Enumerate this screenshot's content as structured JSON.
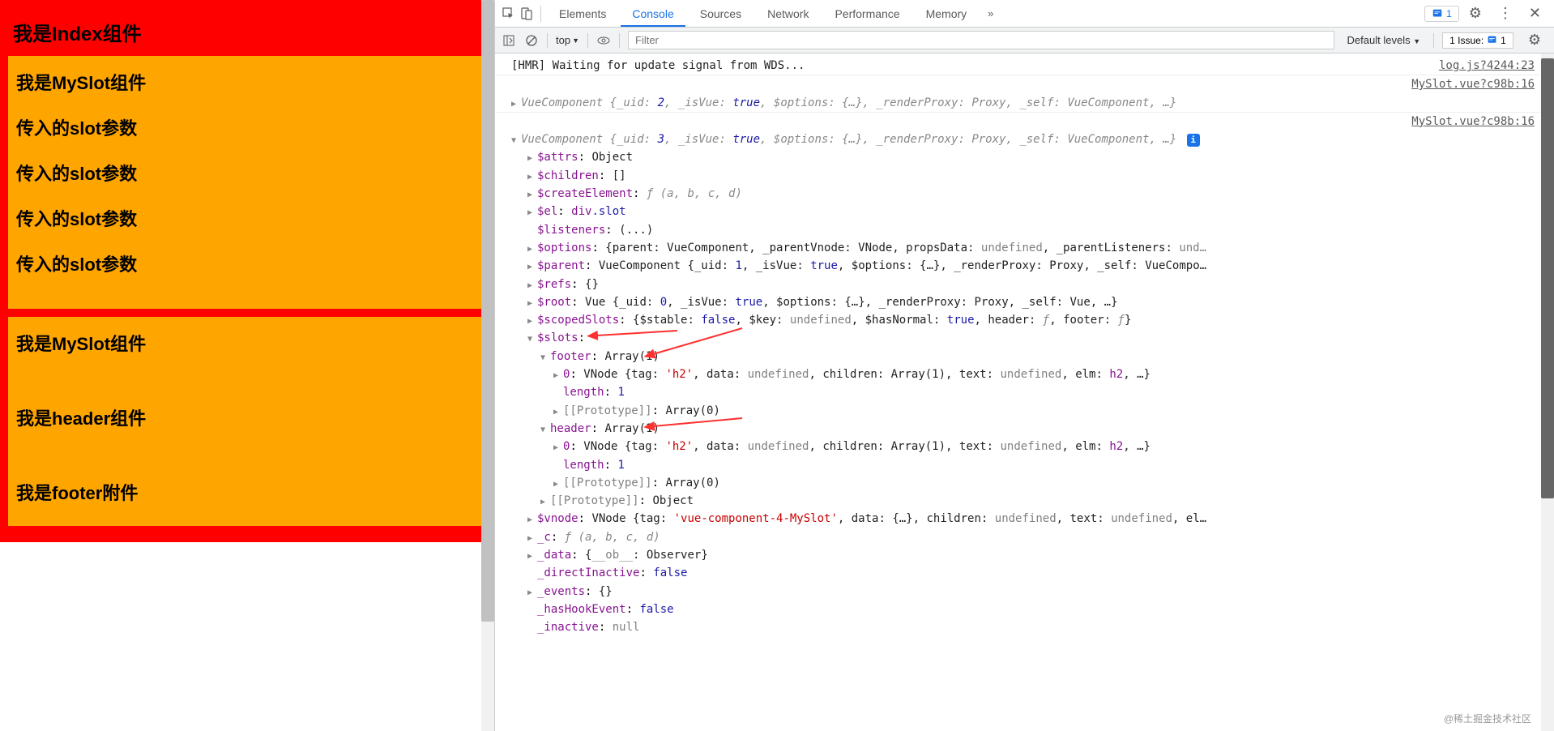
{
  "app": {
    "index_title": "我是Index组件",
    "slot1": {
      "title": "我是MySlot组件",
      "params": [
        "传入的slot参数",
        "传入的slot参数",
        "传入的slot参数",
        "传入的slot参数"
      ]
    },
    "slot2": {
      "title": "我是MySlot组件",
      "header": "我是header组件",
      "footer": "我是footer附件"
    }
  },
  "devtools": {
    "tabs": [
      "Elements",
      "Console",
      "Sources",
      "Network",
      "Performance",
      "Memory"
    ],
    "active_tab": "Console",
    "issue_count": "1",
    "toolbar": {
      "context": "top",
      "filter_placeholder": "Filter",
      "levels": "Default levels",
      "issues_label": "1 Issue:",
      "issues_count": "1"
    },
    "source_links": {
      "log": "log.js?4244:23",
      "myslot": "MySlot.vue?c98b:16"
    },
    "console": {
      "hmr": "[HMR] Waiting for update signal from WDS...",
      "vc1": {
        "prefix": "VueComponent",
        "uid": "2",
        "isVue": "true",
        "proxy": "Proxy",
        "self": "VueComponent"
      },
      "vc2": {
        "prefix": "VueComponent",
        "uid": "3",
        "attrs": "Object",
        "children": "[]",
        "createElement_sig": "ƒ (a, b, c, d)",
        "el": "div.slot",
        "listeners": "(...)",
        "options": "{parent: VueComponent, _parentVnode: VNode, propsData: undefined, _parentListeners: und…",
        "parent": "VueComponent {_uid: 1, _isVue: true, $options: {…}, _renderProxy: Proxy, _self: VueCompo…",
        "refs": "{}",
        "root": "Vue {_uid: 0, _isVue: true, $options: {…}, _renderProxy: Proxy, _self: Vue, …}",
        "scopedSlots": "{$stable: false, $key: undefined, $hasNormal: true, header: ƒ, footer: ƒ}",
        "slots_label": "$slots:",
        "footer_label": "footer",
        "footer_val": "Array(1)",
        "footer_0": "VNode {tag: 'h2', data: undefined, children: Array(1), text: undefined, elm: h2, …}",
        "length_label": "length",
        "length_val": "1",
        "proto_label": "[[Prototype]]",
        "proto_arr": "Array(0)",
        "header_label": "header",
        "header_val": "Array(1)",
        "header_0": "VNode {tag: 'h2', data: undefined, children: Array(1), text: undefined, elm: h2, …}",
        "proto_obj": "Object",
        "vnode": "VNode {tag: 'vue-component-4-MySlot', data: {…}, children: undefined, text: undefined, el…",
        "c_sig": "ƒ (a, b, c, d)",
        "data": "{__ob__: Observer}",
        "directInactive": "false",
        "events": "{}",
        "hasHookEvent": "false",
        "inactive": "null"
      }
    }
  },
  "watermark": "@稀土掘金技术社区"
}
